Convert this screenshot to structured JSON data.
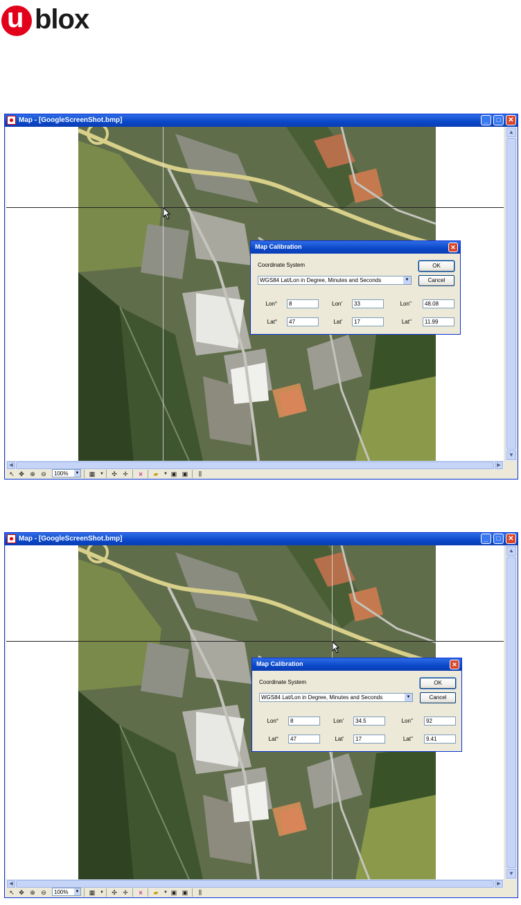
{
  "logo": {
    "u": "u",
    "text": "blox",
    "color": "#e2001a"
  },
  "windows": [
    {
      "title": "Map - [GoogleScreenShot.bmp]",
      "dialog": {
        "title": "Map Calibration",
        "coordinate_label": "Coordinate System",
        "coordinate_value": "WGS84 Lat/Lon in Degree, Minutes and Seconds",
        "ok": "OK",
        "cancel": "Cancel",
        "lon_deg_label": "Lon°",
        "lon_deg": "8",
        "lon_min_label": "Lon'",
        "lon_min": "33",
        "lon_sec_label": "Lon''",
        "lon_sec": "48.08",
        "lat_deg_label": "Lat°",
        "lat_deg": "47",
        "lat_min_label": "Lat'",
        "lat_min": "17",
        "lat_sec_label": "Lat''",
        "lat_sec": "11.99"
      },
      "zoom": "100%"
    },
    {
      "title": "Map - [GoogleScreenShot.bmp]",
      "dialog": {
        "title": "Map Calibration",
        "coordinate_label": "Coordinate System",
        "coordinate_value": "WGS84 Lat/Lon in Degree, Minutes and Seconds",
        "ok": "OK",
        "cancel": "Cancel",
        "lon_deg_label": "Lon°",
        "lon_deg": "8",
        "lon_min_label": "Lon'",
        "lon_min": "34.5",
        "lon_sec_label": "Lon''",
        "lon_sec": "92",
        "lat_deg_label": "Lat°",
        "lat_deg": "47",
        "lat_min_label": "Lat'",
        "lat_min": "17",
        "lat_sec_label": "Lat''",
        "lat_sec": "9.41"
      },
      "zoom": "100%"
    }
  ],
  "colors": {
    "titlebar": "#0a47c8",
    "close": "#d9452a",
    "window_bg": "#ece9d8"
  }
}
